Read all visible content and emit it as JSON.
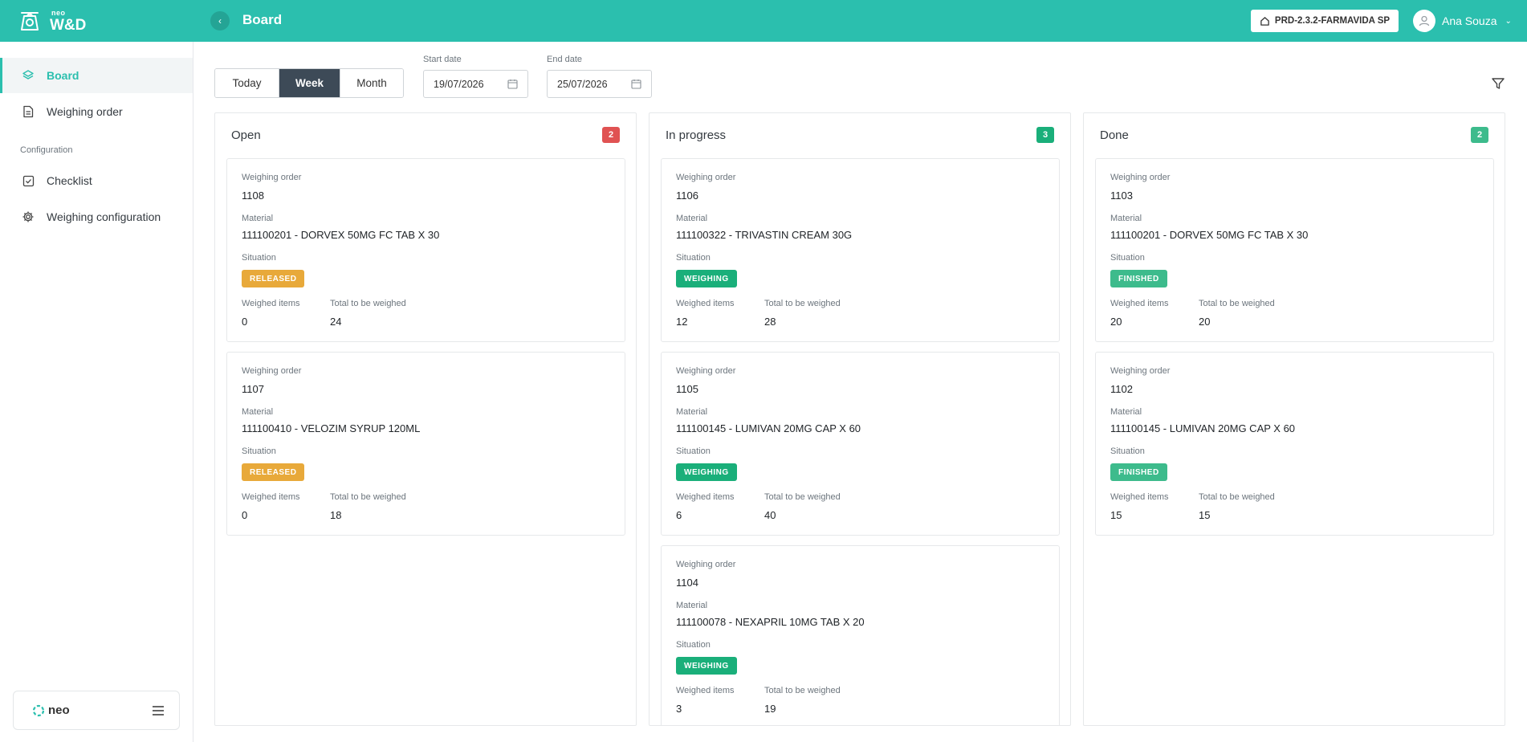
{
  "app": {
    "logo_small": "neo",
    "logo_big": "W&D",
    "page_title": "Board",
    "collapse_icon": "chevron-left-icon"
  },
  "header": {
    "environment": "PRD-2.3.2-FARMAVIDA SP",
    "user_name": "Ana Souza"
  },
  "sidebar": {
    "items": [
      {
        "label": "Board",
        "icon": "layers-icon",
        "active": true
      },
      {
        "label": "Weighing order",
        "icon": "document-icon",
        "active": false
      }
    ],
    "section_label": "Configuration",
    "config_items": [
      {
        "label": "Checklist",
        "icon": "checkbox-icon"
      },
      {
        "label": "Weighing configuration",
        "icon": "gear-icon"
      }
    ],
    "footer_logo": "neo"
  },
  "toolbar": {
    "period_options": [
      "Today",
      "Week",
      "Month"
    ],
    "selected_period": "Week",
    "start_date_label": "Start date",
    "start_date": "19/07/2026",
    "end_date_label": "End date",
    "end_date": "25/07/2026"
  },
  "labels": {
    "weighing_order": "Weighing order",
    "material": "Material",
    "situation": "Situation",
    "weighed_items": "Weighed items",
    "total_to_be_weighed": "Total to be weighed"
  },
  "colors": {
    "brand": "#2bbfae",
    "open_count": "#e05252",
    "progress_count": "#1aaf7a",
    "done_count": "#3dbb8c",
    "released": "#e8a93a",
    "weighing": "#1aaf7a",
    "finished": "#3dbb8c"
  },
  "columns": [
    {
      "title": "Open",
      "count": "2",
      "cards": [
        {
          "order": "1108",
          "material": "111100201 - DORVEX 50MG FC TAB X 30",
          "situation": "RELEASED",
          "weighed": "0",
          "total": "24"
        },
        {
          "order": "1107",
          "material": "111100410 - VELOZIM SYRUP 120ML",
          "situation": "RELEASED",
          "weighed": "0",
          "total": "18"
        }
      ]
    },
    {
      "title": "In progress",
      "count": "3",
      "cards": [
        {
          "order": "1106",
          "material": "111100322 - TRIVASTIN CREAM 30G",
          "situation": "WEIGHING",
          "weighed": "12",
          "total": "28"
        },
        {
          "order": "1105",
          "material": "111100145 - LUMIVAN 20MG CAP X 60",
          "situation": "WEIGHING",
          "weighed": "6",
          "total": "40"
        },
        {
          "order": "1104",
          "material": "111100078 - NEXAPRIL 10MG TAB X 20",
          "situation": "WEIGHING",
          "weighed": "3",
          "total": "19"
        }
      ]
    },
    {
      "title": "Done",
      "count": "2",
      "cards": [
        {
          "order": "1103",
          "material": "111100201 - DORVEX 50MG FC TAB X 30",
          "situation": "FINISHED",
          "weighed": "20",
          "total": "20"
        },
        {
          "order": "1102",
          "material": "111100145 - LUMIVAN 20MG CAP X 60",
          "situation": "FINISHED",
          "weighed": "15",
          "total": "15"
        }
      ]
    }
  ]
}
